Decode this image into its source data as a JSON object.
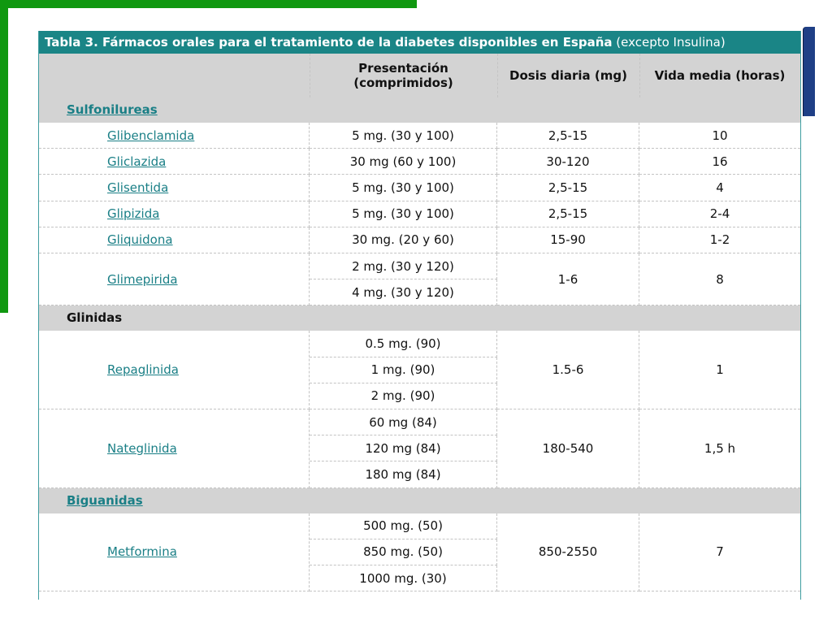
{
  "title": {
    "bold": "Tabla 3. Fármacos orales para el tratamiento de la diabetes disponibles en España",
    "normal": " (excepto Insulina)"
  },
  "headers": {
    "presentacion_line1": "Presentación",
    "presentacion_line2": "(comprimidos)",
    "dosis": "Dosis diaria (mg)",
    "vida": "Vida media (horas)"
  },
  "sections": [
    {
      "label": "Sulfonilureas",
      "link": true
    },
    {
      "label": "Glinidas",
      "link": false
    },
    {
      "label": "Biguanidas",
      "link": true
    }
  ],
  "drugs": [
    {
      "name": "Glibenclamida",
      "presentaciones": [
        "5 mg. (30 y 100)"
      ],
      "dosis": "2,5-15",
      "vida": "10"
    },
    {
      "name": "Gliclazida",
      "presentaciones": [
        "30 mg (60 y 100)"
      ],
      "dosis": "30-120",
      "vida": "16"
    },
    {
      "name": "Glisentida",
      "presentaciones": [
        "5 mg. (30 y 100)"
      ],
      "dosis": "2,5-15",
      "vida": "4"
    },
    {
      "name": "Glipizida",
      "presentaciones": [
        "5 mg. (30 y 100)"
      ],
      "dosis": "2,5-15",
      "vida": "2-4"
    },
    {
      "name": "Gliquidona",
      "presentaciones": [
        "30 mg. (20 y 60)"
      ],
      "dosis": "15-90",
      "vida": "1-2"
    },
    {
      "name": "Glimepirida",
      "presentaciones": [
        "2 mg. (30 y 120)",
        "4 mg. (30 y 120)"
      ],
      "dosis": "1-6",
      "vida": "8"
    },
    {
      "name": "Repaglinida",
      "presentaciones": [
        "0.5 mg. (90)",
        "1 mg. (90)",
        "2 mg. (90)"
      ],
      "dosis": "1.5-6",
      "vida": "1"
    },
    {
      "name": "Nateglinida",
      "presentaciones": [
        "60 mg (84)",
        "120 mg (84)",
        "180 mg (84)"
      ],
      "dosis": "180-540",
      "vida": "1,5 h"
    },
    {
      "name": "Metformina",
      "presentaciones": [
        "500 mg. (50)",
        "850 mg. (50)",
        "1000 mg. (30)"
      ],
      "dosis": "850-2550",
      "vida": "7"
    }
  ],
  "colors": {
    "header_teal": "#1a8586",
    "link": "#1a7f86",
    "frame_green": "#109810",
    "side_tab": "#1f3f86"
  }
}
